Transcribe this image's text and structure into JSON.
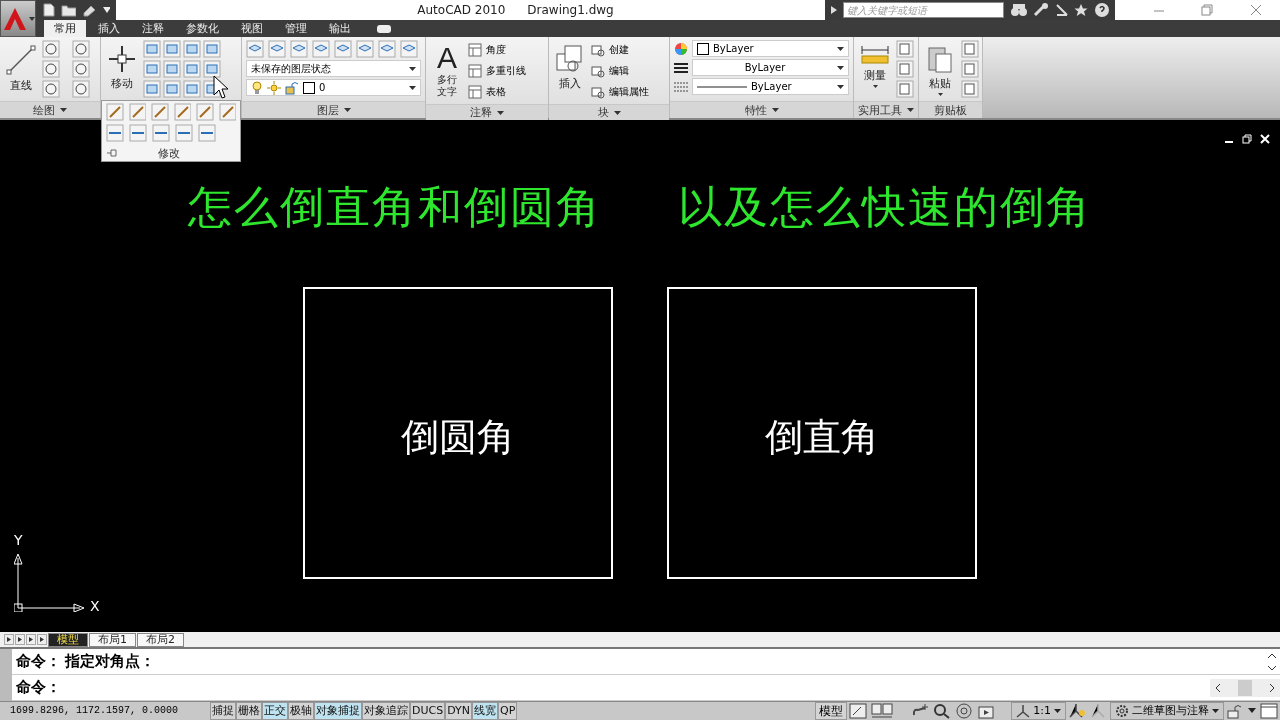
{
  "window": {
    "title": "AutoCAD 2010",
    "document": "Drawing1.dwg"
  },
  "search": {
    "placeholder": "键入关键字或短语"
  },
  "tabs": [
    {
      "label": "常用",
      "selected": true
    },
    {
      "label": "插入",
      "selected": false
    },
    {
      "label": "注释",
      "selected": false
    },
    {
      "label": "参数化",
      "selected": false
    },
    {
      "label": "视图",
      "selected": false
    },
    {
      "label": "管理",
      "selected": false
    },
    {
      "label": "输出",
      "selected": false
    }
  ],
  "ribbon": {
    "panels": [
      {
        "kind": "draw",
        "title": "绘图",
        "big_label": "直线"
      },
      {
        "kind": "modify",
        "title": "修改",
        "big_label": "移动",
        "expanded": true
      },
      {
        "kind": "layer",
        "title": "图层",
        "layer_state": "未保存的图层状态",
        "layer": "0"
      },
      {
        "kind": "annotate",
        "title": "注释",
        "big_glyph": "A",
        "big_label": [
          "多行",
          "文字"
        ],
        "items": [
          "角度",
          "多重引线",
          "表格"
        ]
      },
      {
        "kind": "block",
        "title": "块",
        "big_label": "插入",
        "items": [
          "创建",
          "编辑",
          "编辑属性"
        ]
      },
      {
        "kind": "properties",
        "title": "特性",
        "color_setting": "ByLayer",
        "lineweight": "ByLayer",
        "linetype": "ByLayer"
      },
      {
        "kind": "utilities",
        "title": "实用工具",
        "big_label": "测量"
      },
      {
        "kind": "clipboard",
        "title": "剪贴板",
        "big_label": "粘贴"
      }
    ]
  },
  "canvas": {
    "heading": [
      "怎么倒直角和倒圆角",
      "以及怎么快速的倒角"
    ],
    "shapes": [
      {
        "label": "倒圆角"
      },
      {
        "label": "倒直角"
      }
    ],
    "ucs": {
      "x": "X",
      "y": "Y"
    }
  },
  "layout_tabs": [
    {
      "label": "模型",
      "selected": true
    },
    {
      "label": "布局1",
      "selected": false
    },
    {
      "label": "布局2",
      "selected": false
    }
  ],
  "command_lines": [
    "命令：  指定对角点：",
    "命令："
  ],
  "status_bar": {
    "coordinates": "1699.8296, 1172.1597, 0.0000",
    "toggles": [
      {
        "label": "捕捉",
        "on": false
      },
      {
        "label": "栅格",
        "on": false
      },
      {
        "label": "正交",
        "on": true
      },
      {
        "label": "极轴",
        "on": false
      },
      {
        "label": "对象捕捉",
        "on": true
      },
      {
        "label": "对象追踪",
        "on": false
      },
      {
        "label": "DUCS",
        "on": false
      },
      {
        "label": "DYN",
        "on": false
      },
      {
        "label": "线宽",
        "on": true
      },
      {
        "label": "QP",
        "on": false
      }
    ],
    "space": "模型",
    "annotation_scale": "1:1",
    "workspace": "二维草图与注释"
  }
}
